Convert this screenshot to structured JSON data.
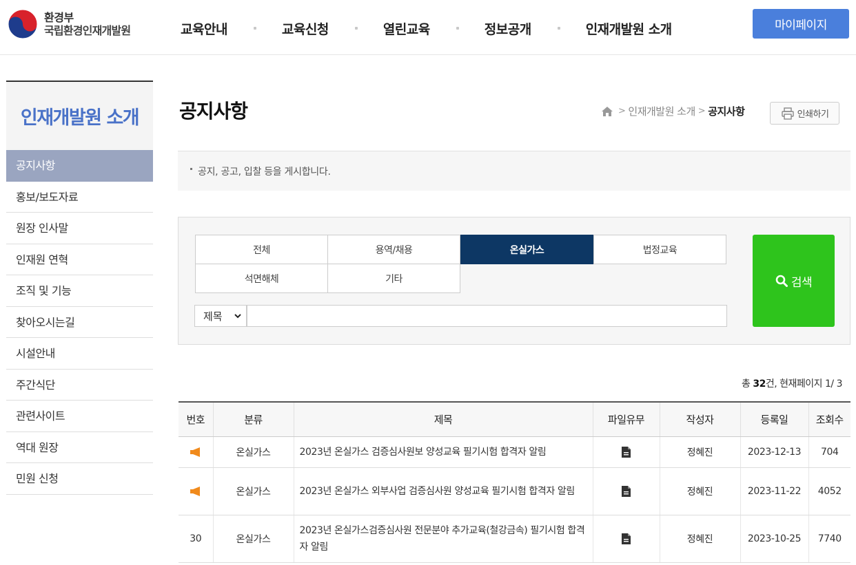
{
  "header": {
    "logo": {
      "ministry": "환경부",
      "org": "국립환경인재개발원"
    },
    "nav": [
      "교육안내",
      "교육신청",
      "열린교육",
      "정보공개",
      "인재개발원 소개"
    ],
    "mypage": "마이페이지"
  },
  "sidebar": {
    "title": "인재개발원 소개",
    "items": [
      "공지사항",
      "홍보/보도자료",
      "원장 인사말",
      "인재원 연혁",
      "조직 및 기능",
      "찾아오시는길",
      "시설안내",
      "주간식단",
      "관련사이트",
      "역대 원장",
      "민원 신청"
    ]
  },
  "page": {
    "title": "공지사항",
    "breadcrumb": {
      "parent": "인재개발원 소개",
      "current": "공지사항"
    },
    "print": "인쇄하기",
    "description": "공지, 공고, 입찰 등을 게시합니다."
  },
  "search": {
    "categories": [
      "전체",
      "용역/채용",
      "온실가스",
      "법정교육",
      "석면해체",
      "기타"
    ],
    "active_category": "온실가스",
    "field": "제목",
    "query": "",
    "button": "검색"
  },
  "summary": {
    "prefix": "총 ",
    "count": "32",
    "suffix": "건, 현재페이지 1/ 3"
  },
  "table": {
    "headers": [
      "번호",
      "분류",
      "제목",
      "파일유무",
      "작성자",
      "등록일",
      "조회수"
    ],
    "rows": [
      {
        "no": "",
        "is_notice": true,
        "category": "온실가스",
        "title": "2023년 온실가스 검증심사원보 양성교육 필기시험 합격자 알림",
        "author": "정혜진",
        "date": "2023-12-13",
        "views": "704"
      },
      {
        "no": "",
        "is_notice": true,
        "category": "온실가스",
        "title": "2023년 온실가스 외부사업 검증심사원 양성교육 필기시험 합격자 알림",
        "author": "정혜진",
        "date": "2023-11-22",
        "views": "4052"
      },
      {
        "no": "30",
        "is_notice": false,
        "category": "온실가스",
        "title": "2023년 온실가스검증심사원 전문분야 추가교육(철강금속) 필기시험 합격자 알림",
        "author": "정혜진",
        "date": "2023-10-25",
        "views": "7740"
      }
    ]
  },
  "colors": {
    "brand_blue": "#4a7fdc",
    "active_navy": "#0d3764",
    "search_green": "#2ec41c",
    "sidebar_active": "#9aa5c0",
    "notice_orange": "#f08a1c"
  },
  "icons": {
    "logo": "taegeuk-icon",
    "home": "home-icon",
    "print": "printer-icon",
    "search": "magnifier-icon",
    "notice": "megaphone-icon",
    "file": "document-icon"
  }
}
